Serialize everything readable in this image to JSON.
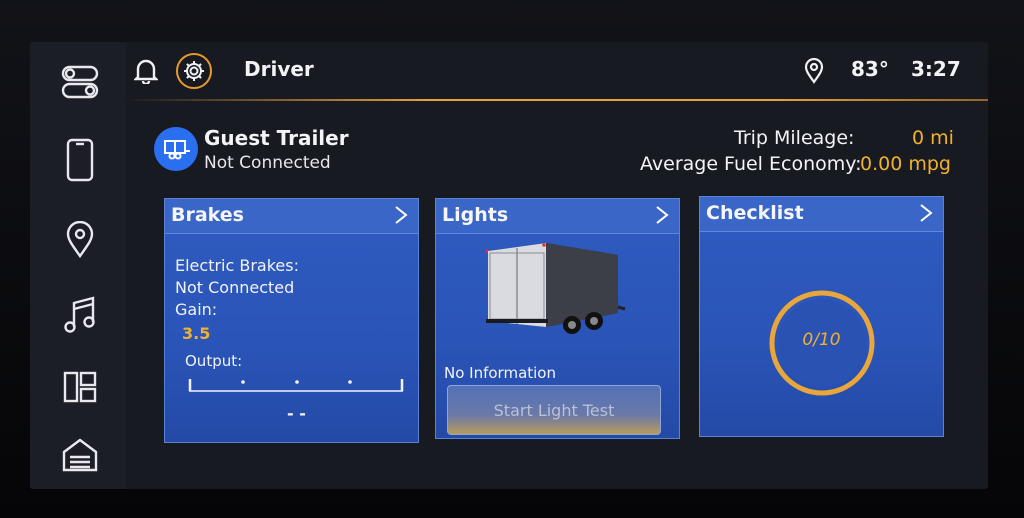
{
  "header": {
    "title": "Driver",
    "temperature": "83°",
    "time": "3:27"
  },
  "sidebar": {
    "items": [
      {
        "icon": "toggle-icon"
      },
      {
        "icon": "phone-icon"
      },
      {
        "icon": "location-pin-icon"
      },
      {
        "icon": "music-note-icon"
      },
      {
        "icon": "apps-grid-icon"
      },
      {
        "icon": "home-icon"
      }
    ]
  },
  "trailer": {
    "name": "Guest Trailer",
    "status": "Not Connected",
    "trip_label": "Trip Mileage:",
    "trip_value": "0 mi",
    "fuel_label": "Average Fuel Economy:",
    "fuel_value": "0.00 mpg"
  },
  "brakes": {
    "title": "Brakes",
    "electric_label": "Electric Brakes:",
    "electric_status": "Not Connected",
    "gain_label": "Gain:",
    "gain_value": "3.5",
    "output_label": "Output:",
    "output_value": "- -"
  },
  "lights": {
    "title": "Lights",
    "info": "No Information",
    "button": "Start Light Test"
  },
  "checklist": {
    "title": "Checklist",
    "progress": "0/10",
    "completed": 0,
    "total": 10
  },
  "colors": {
    "accent": "#f1b12f",
    "card": "#2f5bc0",
    "badge": "#2a6ff0"
  }
}
